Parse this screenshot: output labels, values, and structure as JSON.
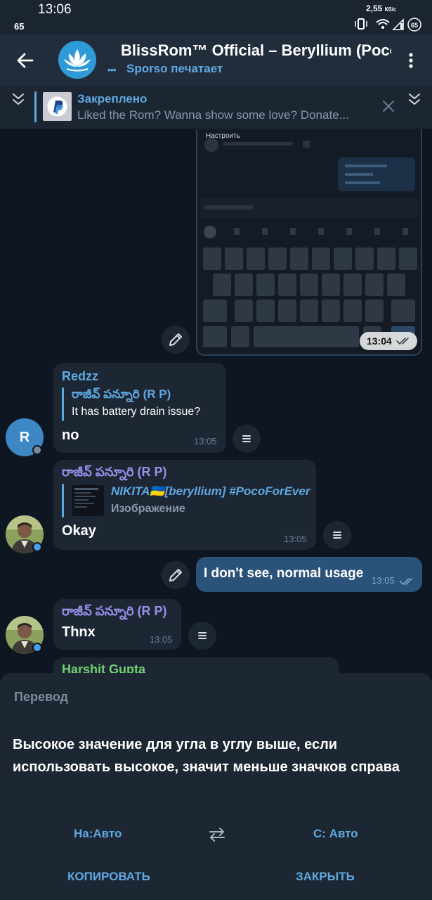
{
  "status_bar": {
    "time": "13:06",
    "notification_count": "65",
    "net_speed": "2,55",
    "net_speed_unit": "Кб/с",
    "battery": "65"
  },
  "header": {
    "title": "BlissRom™ Official – Beryllium (Poco",
    "subtitle": "Sporso печатает",
    "avatar_icon": "lotus-icon"
  },
  "pinned": {
    "title": "Закреплено",
    "text": "Liked the Rom? Wanna show some love? Donate..."
  },
  "image_message": {
    "caption": "Настроить",
    "time": "13:04"
  },
  "messages": [
    {
      "sender": "Redzz",
      "reply_name": "రాజీవ్ పన్నూరి (R P)",
      "reply_text": "It has battery drain issue?",
      "text": "no",
      "time": "13:05",
      "avatar_letter": "R"
    },
    {
      "sender": "రాజీవ్ పన్నూరి (R P)",
      "reply_name": "NIKITA🇺🇦[beryllium] #PocoForEver",
      "reply_text": "Изображение",
      "text": "Okay",
      "time": "13:05"
    },
    {
      "text": "I don't see, normal usage",
      "time": "13:05"
    },
    {
      "sender": "రాజీవ్ పన్నూరి (R P)",
      "text": "Thnx",
      "time": "13:05"
    },
    {
      "sender": "Harshit Gupta"
    }
  ],
  "translation_sheet": {
    "title": "Перевод",
    "text": "Высокое значение для угла в углу выше, если использовать высокое, значит меньше значков справа",
    "to_lang": "На:Авто",
    "from_lang": "С: Авто",
    "copy_label": "КОПИРОВАТЬ",
    "close_label": "ЗАКРЫТЬ"
  },
  "colors": {
    "accent": "#5ea8e0",
    "background": "#0e1621",
    "bubble_in": "#1d2734",
    "bubble_out": "#2b5278",
    "sender_redzz": "#5ea8e0",
    "sender_rp": "#9a8ee8",
    "sender_harshit": "#6fcf6f"
  }
}
